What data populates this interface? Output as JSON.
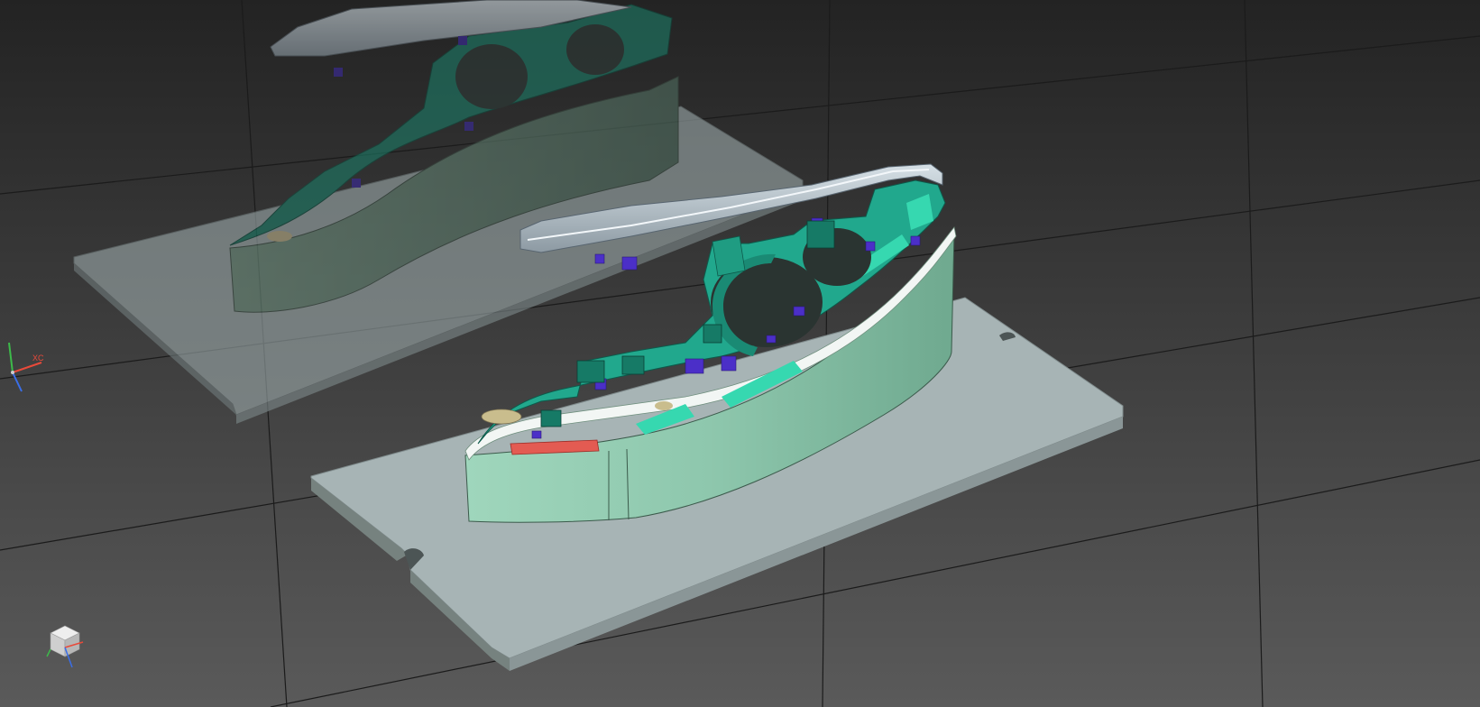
{
  "viewport": {
    "background_top": "#232323",
    "background_bottom": "#5a5a5a",
    "grid_color": "#1b1b1b"
  },
  "triad": {
    "x_label": "XC",
    "x_color": "#e84a3a",
    "y_color": "#3dbb4a",
    "z_color": "#3a6ee8"
  },
  "view_cube": {
    "icon": "view-cube-icon",
    "face_color": "#d8d8d8"
  },
  "colors": {
    "base_plate": "#a7b4b5",
    "base_plate_edge": "#7f8b8c",
    "wall": "#8ec7ad",
    "wall_dark": "#6fa98f",
    "part_body": "#21a88d",
    "part_highlight": "#36d8b0",
    "cover": "#aebcc6",
    "feature_purple": "#4b2fc8",
    "feature_red": "#e35b52"
  }
}
